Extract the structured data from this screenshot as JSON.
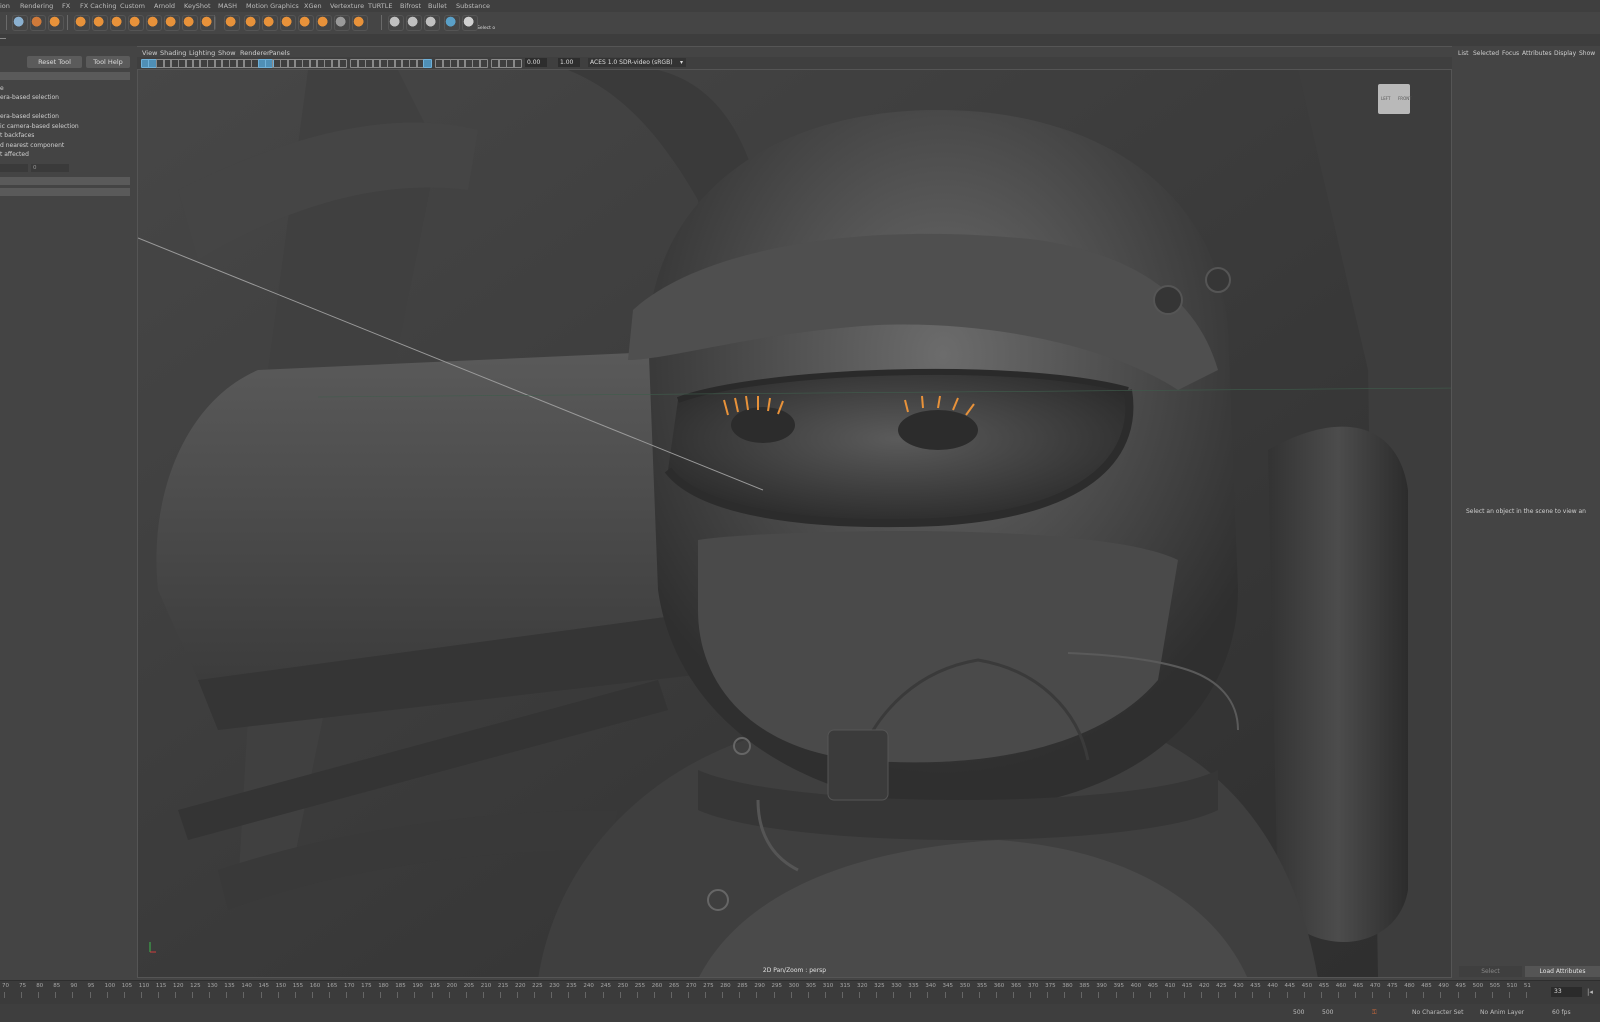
{
  "menubar": {
    "items": [
      "ion",
      "Rendering",
      "FX",
      "FX Caching",
      "Custom",
      "Arnold",
      "KeyShot",
      "MASH",
      "Motion Graphics",
      "XGen",
      "Vertexture",
      "TURTLE",
      "Bifrost",
      "Bullet",
      "Substance"
    ]
  },
  "shelf": {
    "select_label": "Select o",
    "accent_color": "#e8923a",
    "icons": [
      "rotate-tool-icon",
      "lasso-icon",
      "select-icon",
      "cube-icon",
      "sphere-icon",
      "deform-icon",
      "mash-icon",
      "particle-icon",
      "fluid-icon",
      "bend-icon",
      "lattice-icon",
      "sculpt-icon",
      "grid-icon",
      "transform-icon"
    ]
  },
  "tool_panel": {
    "reset_tool": "Reset Tool",
    "tool_help": "Tool Help",
    "options": [
      "e",
      "era-based selection",
      "era-based selection",
      "ic camera-based selection",
      "t backfaces",
      "d nearest component",
      "t affected"
    ],
    "field_value": "0"
  },
  "viewport": {
    "menu": [
      "View",
      "Shading",
      "Lighting",
      "Show",
      "Renderer",
      "Panels"
    ],
    "exposure": "0.00",
    "gamma": "1.00",
    "color_space": "ACES 1.0 SDR-video (sRGB)",
    "label": "2D Pan/Zoom : persp",
    "viewcube_left": "LEFT",
    "viewcube_front": "FRONT"
  },
  "attr_panel": {
    "tabs": [
      "List",
      "Selected",
      "Focus",
      "Attributes",
      "Display",
      "Show"
    ],
    "message": "Select an object in the scene to view an",
    "select_button": "Select",
    "load_attributes": "Load Attributes"
  },
  "timeline": {
    "current_frame": "33",
    "ticks": [
      "70",
      "75",
      "80",
      "85",
      "90",
      "95",
      "100",
      "105",
      "110",
      "115",
      "120",
      "125",
      "130",
      "135",
      "140",
      "145",
      "150",
      "155",
      "160",
      "165",
      "170",
      "175",
      "180",
      "185",
      "190",
      "195",
      "200",
      "205",
      "210",
      "215",
      "220",
      "225",
      "230",
      "235",
      "240",
      "245",
      "250",
      "255",
      "260",
      "265",
      "270",
      "275",
      "280",
      "285",
      "290",
      "295",
      "300",
      "305",
      "310",
      "315",
      "320",
      "325",
      "330",
      "335",
      "340",
      "345",
      "350",
      "355",
      "360",
      "365",
      "370",
      "375",
      "380",
      "385",
      "390",
      "395",
      "400",
      "405",
      "410",
      "415",
      "420",
      "425",
      "430",
      "435",
      "440",
      "445",
      "450",
      "455",
      "460",
      "465",
      "470",
      "475",
      "480",
      "485",
      "490",
      "495",
      "500",
      "505",
      "510",
      "51"
    ]
  },
  "range_bar": {
    "start": "500",
    "end": "500",
    "character_set": "No Character Set",
    "anim_layer": "No Anim Layer",
    "fps": "60 fps"
  }
}
